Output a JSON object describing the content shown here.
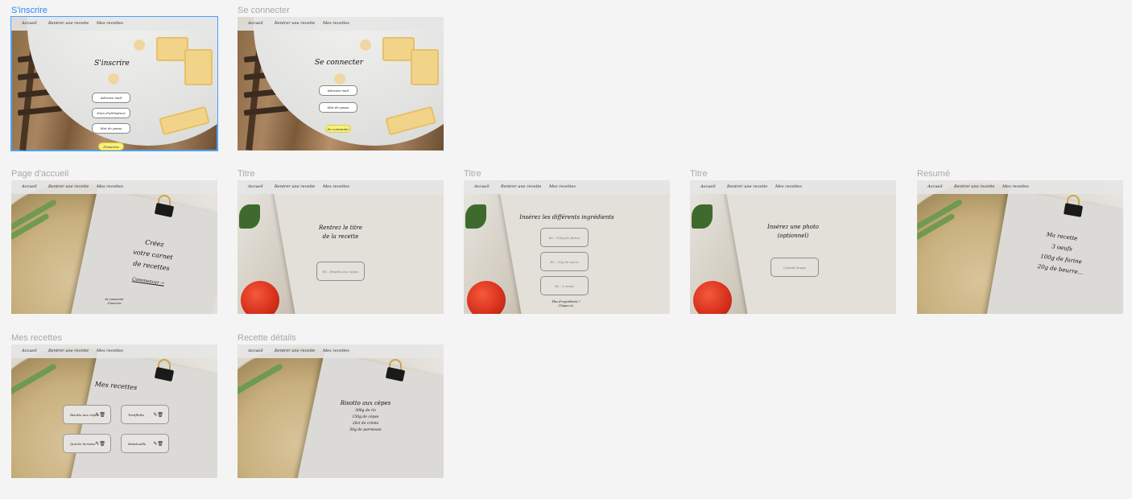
{
  "nav": {
    "home": "Accueil",
    "add_recipe": "Rentrer une recette",
    "my_recipes": "Mes recettes"
  },
  "frames": {
    "signup": {
      "label": "S'inscrire",
      "title": "S'inscrire",
      "email": "Adresse mail",
      "username": "Nom d'utilisateur",
      "password": "Mot de passe",
      "submit": "S'inscrire"
    },
    "login": {
      "label": "Se connecter",
      "title": "Se connecter",
      "email": "Adresse mail",
      "password": "Mot de passe",
      "submit": "Se connecter"
    },
    "home": {
      "label": "Page d'accueil",
      "line1": "Créez",
      "line2": "votre carnet",
      "line3": "de recettes",
      "cta": "Commencer →",
      "footer1": "Se connecter",
      "footer2": "S'inscrire"
    },
    "title_step": {
      "label": "Titre",
      "line1": "Rentrez le titre",
      "line2": "de la recette",
      "input": "Ex : Risotto aux cèpes"
    },
    "ingredients_step": {
      "label": "Titre",
      "title": "Insérez les différents ingrédients",
      "field1": "Ex : 100g de farine",
      "field2": "Ex : 20g de sucre",
      "field3": "Ex : 3 oeufs",
      "footer1": "Plus d'ingrédients ?",
      "footer2": "Cliquez ici"
    },
    "photo_step": {
      "label": "Titre",
      "line1": "Insérez une photo",
      "line2": "(optionnel)",
      "upload": "Upload image"
    },
    "summary": {
      "label": "Resumé",
      "line1": "Ma recette",
      "line2": "3 oeufs",
      "line3": "100g de farine",
      "line4": "20g de beurre..."
    },
    "my_recipes": {
      "label": "Mes recettes",
      "title": "Mes recettes",
      "recipes": [
        "Risotto aux cèpes",
        "Tartiflette",
        "Quiche lorraine",
        "Ratatouille"
      ]
    },
    "detail": {
      "label": "Recette détails",
      "title": "Risotto aux cèpes",
      "line1": "300g de riz",
      "line2": "150g de cèpes",
      "line3": "20cl de crème",
      "line4": "50g de parmesan"
    }
  },
  "icons": {
    "edit": "pencil-icon",
    "delete": "trash-icon"
  },
  "colors": {
    "selection": "#4aa0f7",
    "label_selected": "#2f86f6",
    "label": "#a8a8a8",
    "button_yellow": "#f7f07a"
  }
}
